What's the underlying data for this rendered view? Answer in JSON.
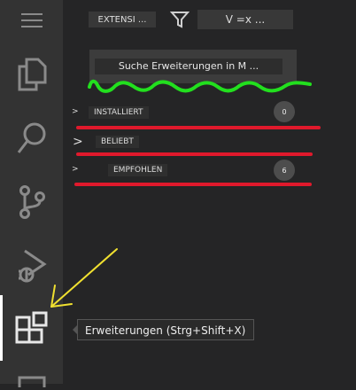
{
  "activity_bar": {
    "items": [
      {
        "name": "menu-icon"
      },
      {
        "name": "explorer-icon"
      },
      {
        "name": "search-icon"
      },
      {
        "name": "source-control-icon"
      },
      {
        "name": "run-debug-icon"
      },
      {
        "name": "extensions-icon"
      }
    ]
  },
  "header": {
    "title": "EXTENSI ...",
    "filter_icon": "filter-icon",
    "view_more": "V =x ..."
  },
  "search": {
    "placeholder": "Suche Erweiterungen in M ..."
  },
  "sections": [
    {
      "chevron": ">",
      "label": "INSTALLIERT",
      "count": "0"
    },
    {
      "chevron": ">",
      "label": "BELIEBT"
    },
    {
      "chevron": ">",
      "label": "EMPFOHLEN",
      "count": "6"
    }
  ],
  "tooltip": {
    "text": "Erweiterungen (Strg+Shift+X)"
  },
  "colors": {
    "activity_bar": "#333333",
    "sidebar": "#252526",
    "annotation_green": "#22e01e",
    "annotation_red": "#e0192c",
    "annotation_yellow": "#f0e030"
  }
}
